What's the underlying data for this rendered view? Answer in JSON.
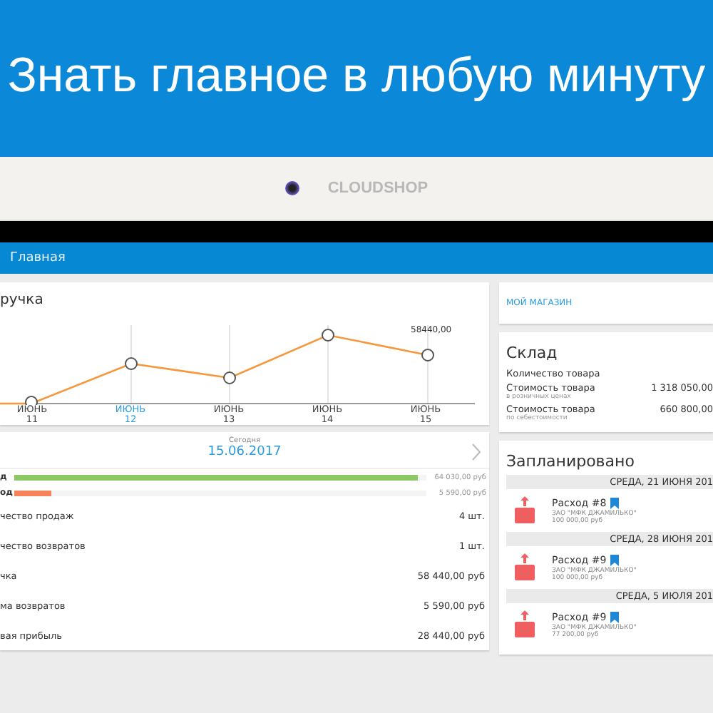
{
  "hero": {
    "title": "Знать главное в любую минуту"
  },
  "brand": {
    "name": "CLOUDSHOP"
  },
  "nav": {
    "title": "Главная"
  },
  "revenue_chart": {
    "title": "ручка",
    "point_label": "58440,00",
    "x_labels": [
      {
        "month": "ИЮНЬ",
        "day": "11",
        "selected": false
      },
      {
        "month": "ИЮНЬ",
        "day": "12",
        "selected": true
      },
      {
        "month": "ИЮНЬ",
        "day": "13",
        "selected": false
      },
      {
        "month": "ИЮНЬ",
        "day": "14",
        "selected": false
      },
      {
        "month": "ИЮНЬ",
        "day": "15",
        "selected": false
      }
    ]
  },
  "day_summary": {
    "caption": "Сегодня",
    "date": "15.06.2017",
    "bars": [
      {
        "label": "д",
        "level": 0.98,
        "value": "64 030,00 руб",
        "color": "#8cc866"
      },
      {
        "label": "од",
        "level": 0.09,
        "value": "5 590,00 руб",
        "color": "#f5845a"
      }
    ],
    "rows": [
      {
        "label": "чество продаж",
        "value": "4 шт."
      },
      {
        "label": "чество возвратов",
        "value": "1 шт."
      },
      {
        "label": "чка",
        "value": "58 440,00 руб"
      },
      {
        "label": "ма возвратов",
        "value": "5 590,00 руб"
      },
      {
        "label": "вая прибыль",
        "value": "28 440,00 руб"
      }
    ]
  },
  "store": {
    "link": "МОЙ МАГАЗИН"
  },
  "warehouse": {
    "title": "Склад",
    "rows": [
      {
        "label": "Количество товара"
      },
      {
        "label": "Стоимость товара",
        "note": "в розничных ценах",
        "value": "1 318 050,00"
      },
      {
        "label": "Стоимость товара",
        "note": "по себестоимости",
        "value": "660 800,00"
      }
    ]
  },
  "planned": {
    "title": "Запланировано",
    "groups": [
      {
        "date": "СРЕДА, 21 ИЮНЯ 201",
        "items": [
          {
            "title": "Расход #8",
            "company": "ЗАО \"МФК ДЖАМИЛЬКО\"",
            "amount": "100 000,00 руб"
          }
        ]
      },
      {
        "date": "СРЕДА, 28 ИЮНЯ 201",
        "items": [
          {
            "title": "Расход #9",
            "company": "ЗАО \"МФК ДЖАМИЛЬКО\"",
            "amount": "100 000,00 руб"
          }
        ]
      },
      {
        "date": "СРЕДА, 5 ИЮЛЯ 201",
        "items": [
          {
            "title": "Расход #9",
            "company": "ЗАО \"МФК ДЖАМИЛЬКО\"",
            "amount": "77 200,00 руб"
          }
        ]
      }
    ]
  }
}
